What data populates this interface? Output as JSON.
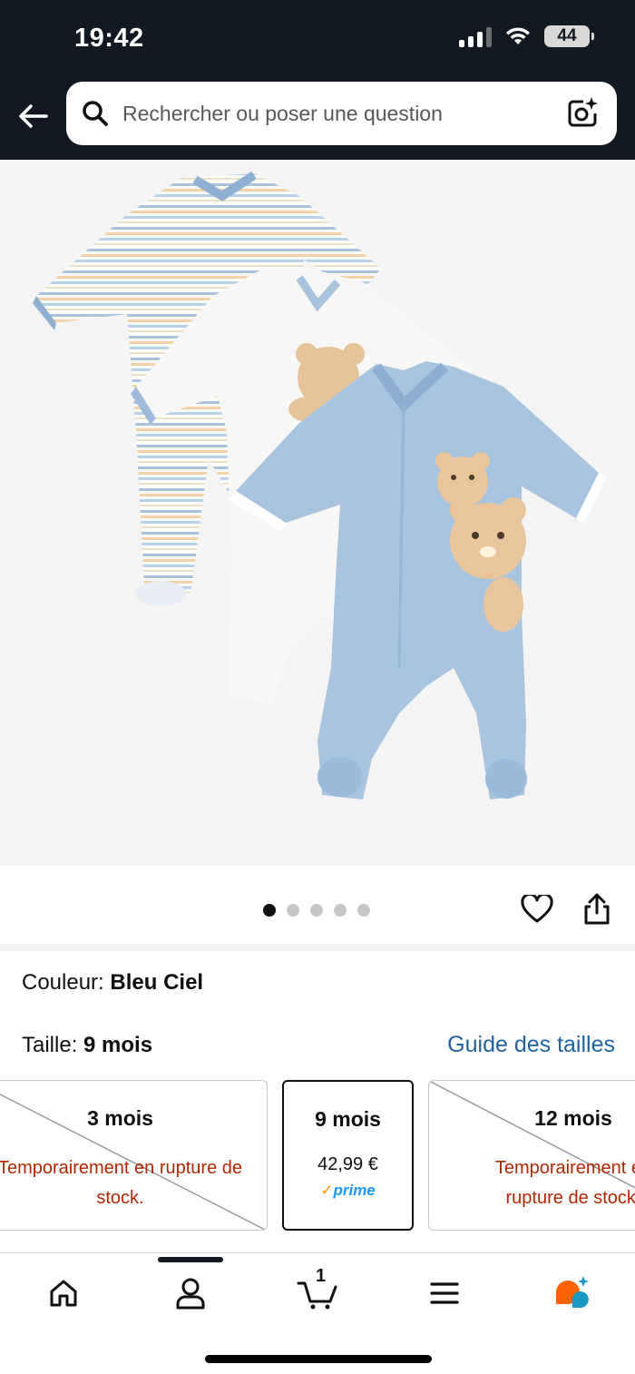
{
  "status_bar": {
    "time": "19:42",
    "battery": "44"
  },
  "header": {
    "search_placeholder": "Rechercher ou poser une question"
  },
  "product": {
    "image_icon": "baby-sleepsuits-image",
    "carousel": {
      "total": 5,
      "active": 1
    }
  },
  "variations": {
    "color_label": "Couleur:",
    "color_value": "Bleu Ciel",
    "size_label": "Taille:",
    "size_value": "9 mois",
    "size_guide": "Guide des tailles",
    "sizes": [
      {
        "label": "3 mois",
        "status": "Temporairement en rupture de stock.",
        "available": false
      },
      {
        "label": "9 mois",
        "price": "42,99 €",
        "prime": "prime",
        "available": true,
        "selected": true
      },
      {
        "label": "12 mois",
        "status": "Temporairement en rupture de stock.",
        "available": false
      }
    ]
  },
  "bottom_nav": {
    "cart_count": "1",
    "items": [
      "home-icon",
      "account-icon",
      "cart-icon",
      "menu-icon",
      "rufus-icon"
    ]
  },
  "colors": {
    "header_bg": "#131921",
    "link": "#2162a1",
    "out_of_stock": "#b12704",
    "prime_blue": "#1a98ff",
    "prime_check": "#ff9900"
  }
}
